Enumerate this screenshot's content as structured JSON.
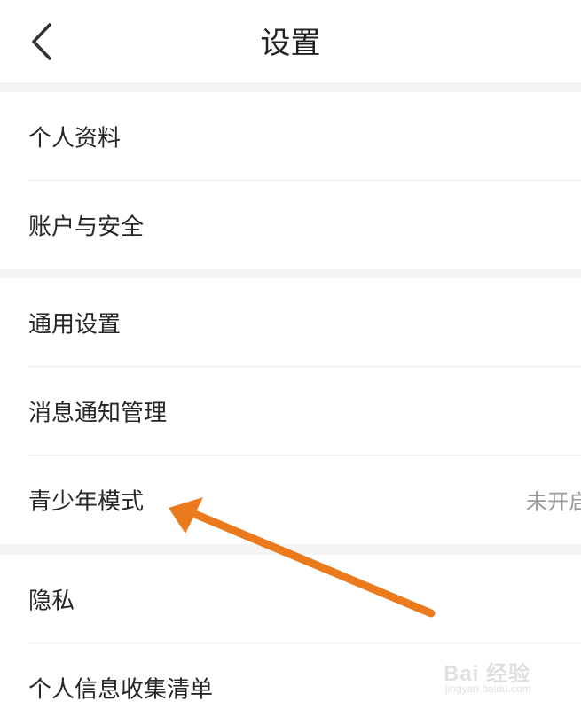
{
  "header": {
    "title": "设置",
    "back_icon": "chevron-left-icon"
  },
  "groups": [
    {
      "items": [
        {
          "label": "个人资料",
          "value": ""
        },
        {
          "label": "账户与安全",
          "value": ""
        }
      ]
    },
    {
      "items": [
        {
          "label": "通用设置",
          "value": ""
        },
        {
          "label": "消息通知管理",
          "value": ""
        },
        {
          "label": "青少年模式",
          "value": "未开启"
        }
      ]
    },
    {
      "items": [
        {
          "label": "隐私",
          "value": ""
        },
        {
          "label": "个人信息收集清单",
          "value": ""
        }
      ]
    }
  ],
  "annotation": {
    "arrow_color": "#ea7a1c",
    "icon": "arrow-annotation"
  },
  "watermark": {
    "brand": "Bai 经验",
    "url": "jingyan.baidu.com"
  },
  "colors": {
    "background": "#f4f4f4",
    "card": "#ffffff",
    "text": "#262626",
    "secondary_text": "#9a9a9a"
  }
}
